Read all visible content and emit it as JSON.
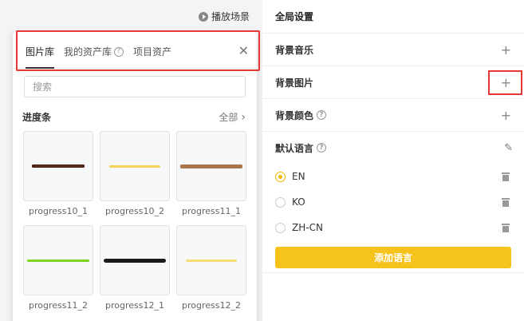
{
  "toolbar": {
    "play_label": "播放场景",
    "play_icon": "play-circle-icon"
  },
  "popup": {
    "tabs": [
      {
        "label": "图片库",
        "active": true
      },
      {
        "label": "我的资产库",
        "help": true
      },
      {
        "label": "项目资产"
      }
    ],
    "close_icon": "close-icon",
    "search": {
      "placeholder": "搜索",
      "value": ""
    },
    "section": {
      "title": "进度条",
      "all_label": "全部"
    },
    "assets": [
      {
        "name": "progress10_1",
        "color": "#5a2f16"
      },
      {
        "name": "progress10_2",
        "color": "#f3d35c"
      },
      {
        "name": "progress11_1",
        "color": "#a8764a"
      },
      {
        "name": "progress11_2",
        "color": "#7ed321"
      },
      {
        "name": "progress12_1",
        "color": "#1a1a1a"
      },
      {
        "name": "progress12_2",
        "color": "#f6dc75"
      }
    ]
  },
  "panel": {
    "title": "全局设置",
    "rows": [
      {
        "label": "背景音乐"
      },
      {
        "label": "背景图片"
      },
      {
        "label": "背景颜色",
        "help": true
      }
    ],
    "languages": {
      "title": "默认语言",
      "items": [
        {
          "code": "EN",
          "selected": true
        },
        {
          "code": "KO",
          "selected": false
        },
        {
          "code": "ZH-CN",
          "selected": false
        }
      ],
      "add_label": "添加语言"
    }
  },
  "colors": {
    "accent": "#f6c21c",
    "highlight": "#e53935"
  }
}
